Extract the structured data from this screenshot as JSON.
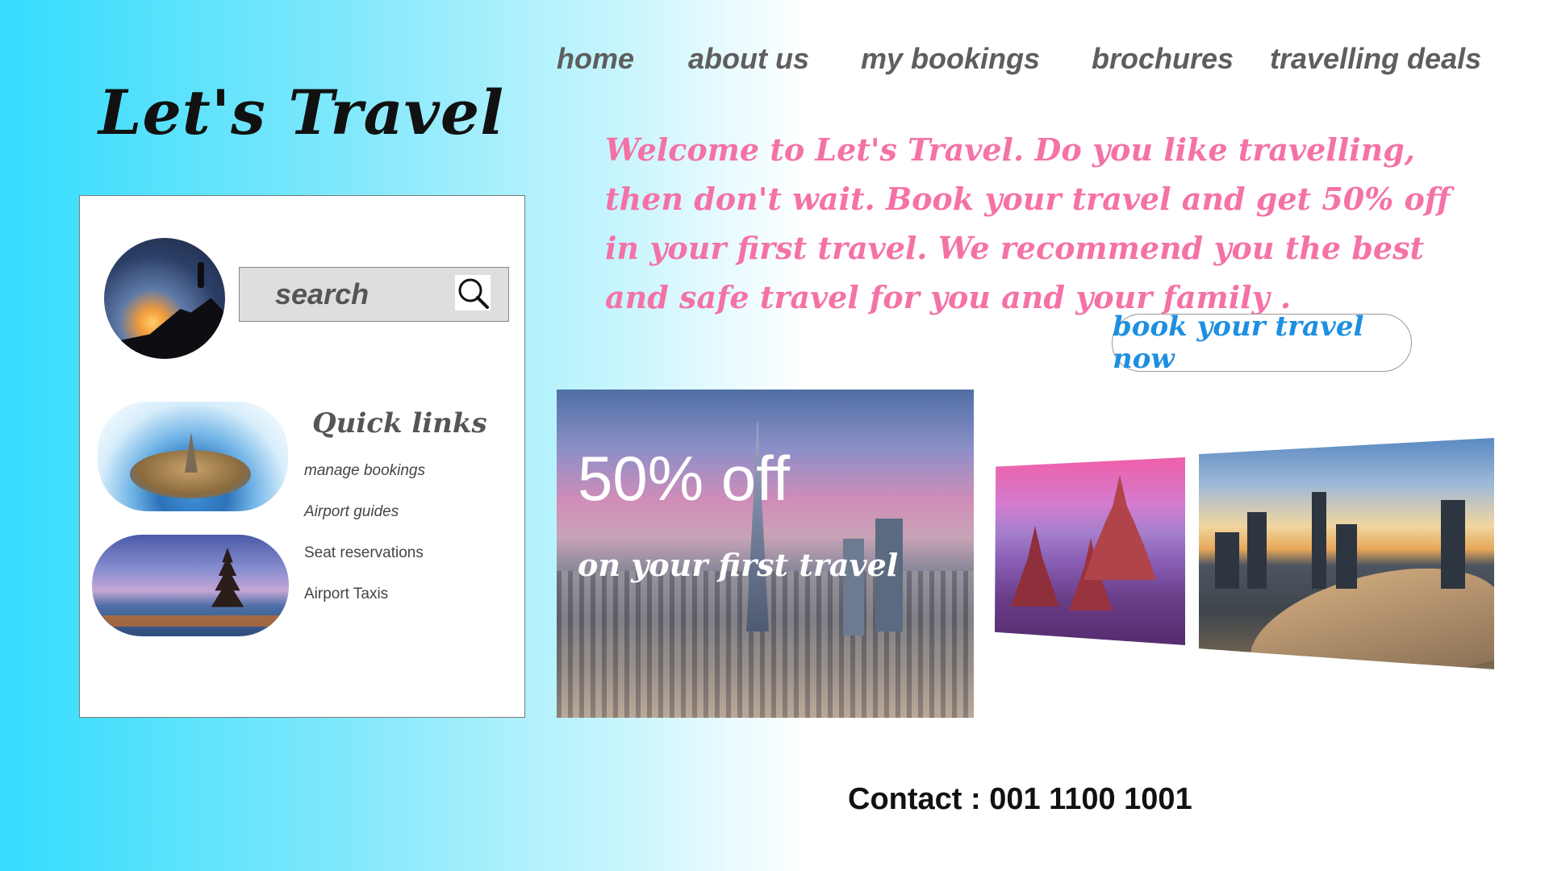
{
  "brand": {
    "logo_text": "Let's Travel"
  },
  "nav": {
    "items": [
      {
        "label": "home"
      },
      {
        "label": "about us"
      },
      {
        "label": "my bookings"
      },
      {
        "label": "brochures"
      },
      {
        "label": "travelling deals"
      }
    ]
  },
  "hero": {
    "welcome_text": "Welcome to Let's Travel. Do you like travelling, then don't wait. Book your travel and get 50% off in your first travel. We recommend you the best and safe travel for you and your family .",
    "cta_label": "book your travel now"
  },
  "sidebar": {
    "search": {
      "placeholder": "search",
      "value": "",
      "icon": "search-icon"
    },
    "quick_links_title": "Quick links",
    "quick_links": [
      {
        "label": "manage bookings"
      },
      {
        "label": "Airport guides"
      },
      {
        "label": "Seat reservations"
      },
      {
        "label": "Airport Taxis"
      }
    ]
  },
  "promo": {
    "headline": "50% off",
    "subline": "on your first travel"
  },
  "footer": {
    "contact": "Contact : 001 1100 1001"
  },
  "colors": {
    "accent_pink": "#f472a6",
    "cta_blue": "#1d8fe0",
    "nav_gray": "#5e5e5e",
    "bg_cyan": "#33dcfd"
  }
}
